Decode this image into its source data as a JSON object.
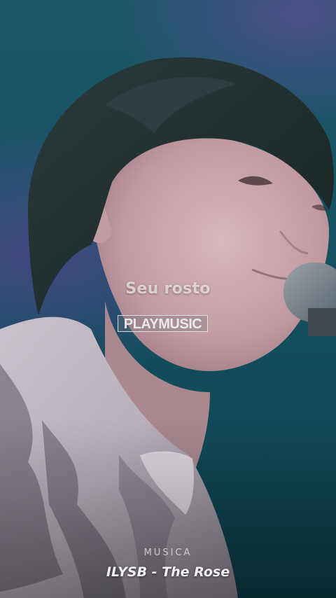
{
  "video": {
    "description_icon": "singer-photo"
  },
  "lyric_text": "Seu rosto",
  "watermark_text": "PLAYMUSIC",
  "caption": {
    "label": "MUSICA",
    "song_title": "ILYSB - The Rose"
  }
}
